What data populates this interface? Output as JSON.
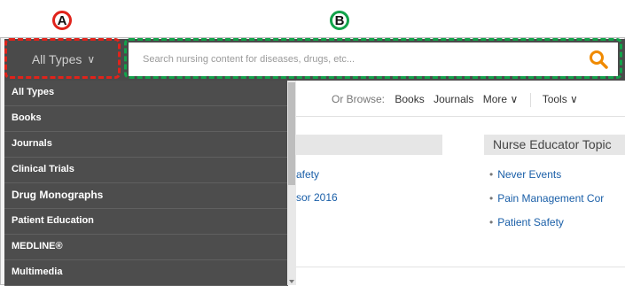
{
  "annotations": {
    "a": "A",
    "b": "B"
  },
  "type_selector": {
    "label": "All Types",
    "chevron": "∨"
  },
  "search": {
    "placeholder": "Search nursing content for diseases, drugs, etc..."
  },
  "dropdown": {
    "items": [
      "All Types",
      "Books",
      "Journals",
      "Clinical Trials",
      "Drug Monographs",
      "Patient Education",
      "MEDLINE®",
      "Multimedia"
    ]
  },
  "browse": {
    "label": "Or Browse:",
    "books": "Books",
    "journals": "Journals",
    "more": "More ∨",
    "tools": "Tools ∨"
  },
  "left_links": [
    "afety",
    "sor 2016"
  ],
  "right_panel": {
    "title": "Nurse Educator Topic",
    "links": [
      "Never Events",
      "Pain Management Cor",
      "Patient Safety"
    ]
  },
  "colors": {
    "badge_a": "#e0231b",
    "badge_b": "#12a34a",
    "search_icon": "#f08a00",
    "topbar": "#4a4a4a"
  }
}
